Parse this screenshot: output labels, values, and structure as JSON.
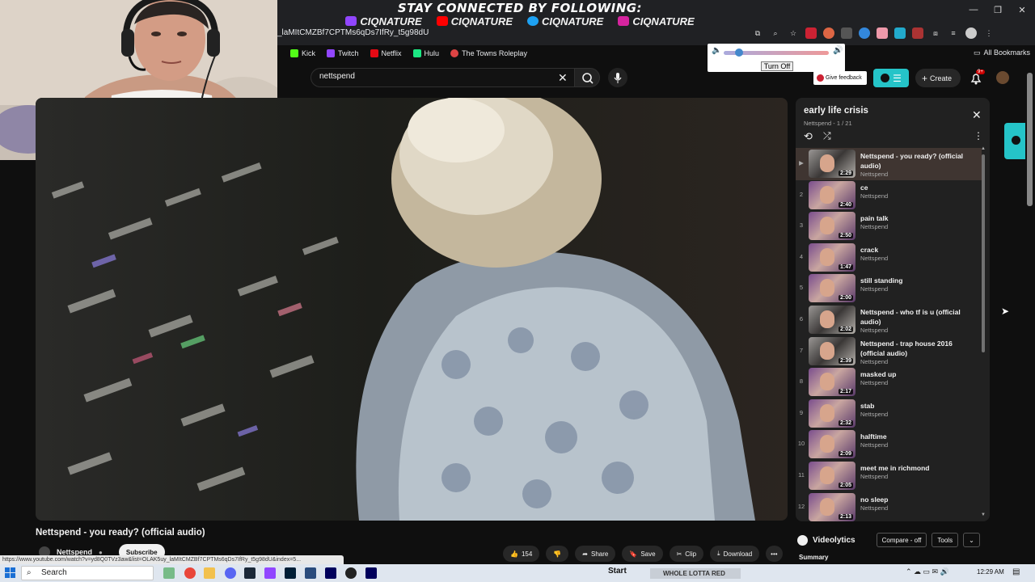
{
  "banner": {
    "title": "STAY CONNECTED BY FOLLOWING:",
    "socials": [
      {
        "handle": "CIQNATURE",
        "icon": "twitch-icon",
        "color": "#9146ff"
      },
      {
        "handle": "CIQNATURE",
        "icon": "youtube-icon",
        "color": "#ff0000"
      },
      {
        "handle": "CIQNATURE",
        "icon": "twitter-icon",
        "color": "#1da1f2"
      },
      {
        "handle": "CIQNATURE",
        "icon": "instagram-icon",
        "color": "#d6249f"
      }
    ]
  },
  "browser": {
    "address_fragment": "_laMItCMZBf7CPTMs6qDs7IfRy_t5g98dU",
    "bookmarks": [
      {
        "label": "Kick",
        "icon": "kick-icon",
        "color": "#53fc18"
      },
      {
        "label": "Twitch",
        "icon": "twitch-icon",
        "color": "#9146ff"
      },
      {
        "label": "Netflix",
        "icon": "netflix-icon",
        "color": "#e50914"
      },
      {
        "label": "Hulu",
        "icon": "hulu-icon",
        "color": "#1ce783"
      },
      {
        "label": "The Towns Roleplay",
        "icon": "towns-icon",
        "color": "#d44"
      }
    ],
    "all_bookmarks": "All Bookmarks",
    "status_url": "https://www.youtube.com/watch?v=yd8Q0TVz3aw&list=OLAK5uy_laMItCMZBf7CPTMs6qDs7IfRy_t5g98dU&index=5..."
  },
  "volume_popup": {
    "turn_off_label": "Turn Off"
  },
  "youtube": {
    "search_value": "nettspend",
    "feedback_label": "Give feedback",
    "create_label": "Create",
    "notification_count": "9+"
  },
  "video": {
    "title": "Nettspend - you ready? (official audio)",
    "channel": "Nettspend",
    "subscribe_label": "Subscribe",
    "like_count": "154",
    "share_label": "Share",
    "save_label": "Save",
    "clip_label": "Clip",
    "download_label": "Download"
  },
  "playlist": {
    "title": "early life crisis",
    "subtitle": "Nettspend - 1 / 21",
    "items": [
      {
        "index": "▶",
        "title": "Nettspend - you ready? (official audio)",
        "channel": "Nettspend",
        "duration": "2:29",
        "thumb": "grey"
      },
      {
        "index": "2",
        "title": "ce",
        "channel": "Nettspend",
        "duration": "2:40",
        "thumb": "pink"
      },
      {
        "index": "3",
        "title": "pain talk",
        "channel": "Nettspend",
        "duration": "2:50",
        "thumb": "pink"
      },
      {
        "index": "4",
        "title": "crack",
        "channel": "Nettspend",
        "duration": "1:47",
        "thumb": "pink"
      },
      {
        "index": "5",
        "title": "still standing",
        "channel": "Nettspend",
        "duration": "2:00",
        "thumb": "pink"
      },
      {
        "index": "6",
        "title": "Nettspend - who tf is u (official audio)",
        "channel": "Nettspend",
        "duration": "2:02",
        "thumb": "grey"
      },
      {
        "index": "7",
        "title": "Nettspend - trap house 2016 (official audio)",
        "channel": "Nettspend",
        "duration": "2:39",
        "thumb": "grey"
      },
      {
        "index": "8",
        "title": "masked up",
        "channel": "Nettspend",
        "duration": "2:17",
        "thumb": "pink"
      },
      {
        "index": "9",
        "title": "stab",
        "channel": "Nettspend",
        "duration": "2:32",
        "thumb": "pink"
      },
      {
        "index": "10",
        "title": "halftime",
        "channel": "Nettspend",
        "duration": "2:09",
        "thumb": "pink"
      },
      {
        "index": "11",
        "title": "meet me in richmond",
        "channel": "Nettspend",
        "duration": "2:05",
        "thumb": "pink"
      },
      {
        "index": "12",
        "title": "no sleep",
        "channel": "Nettspend",
        "duration": "2:13",
        "thumb": "pink"
      }
    ]
  },
  "videolytics": {
    "name": "Videolytics",
    "compare_label": "Compare - off",
    "tools_label": "Tools",
    "summary_label": "Summary"
  },
  "taskbar": {
    "search_placeholder": "Search",
    "now_playing": "WHOLE LOTTA RED",
    "start_label": "Start",
    "clock": "12:29 AM"
  }
}
